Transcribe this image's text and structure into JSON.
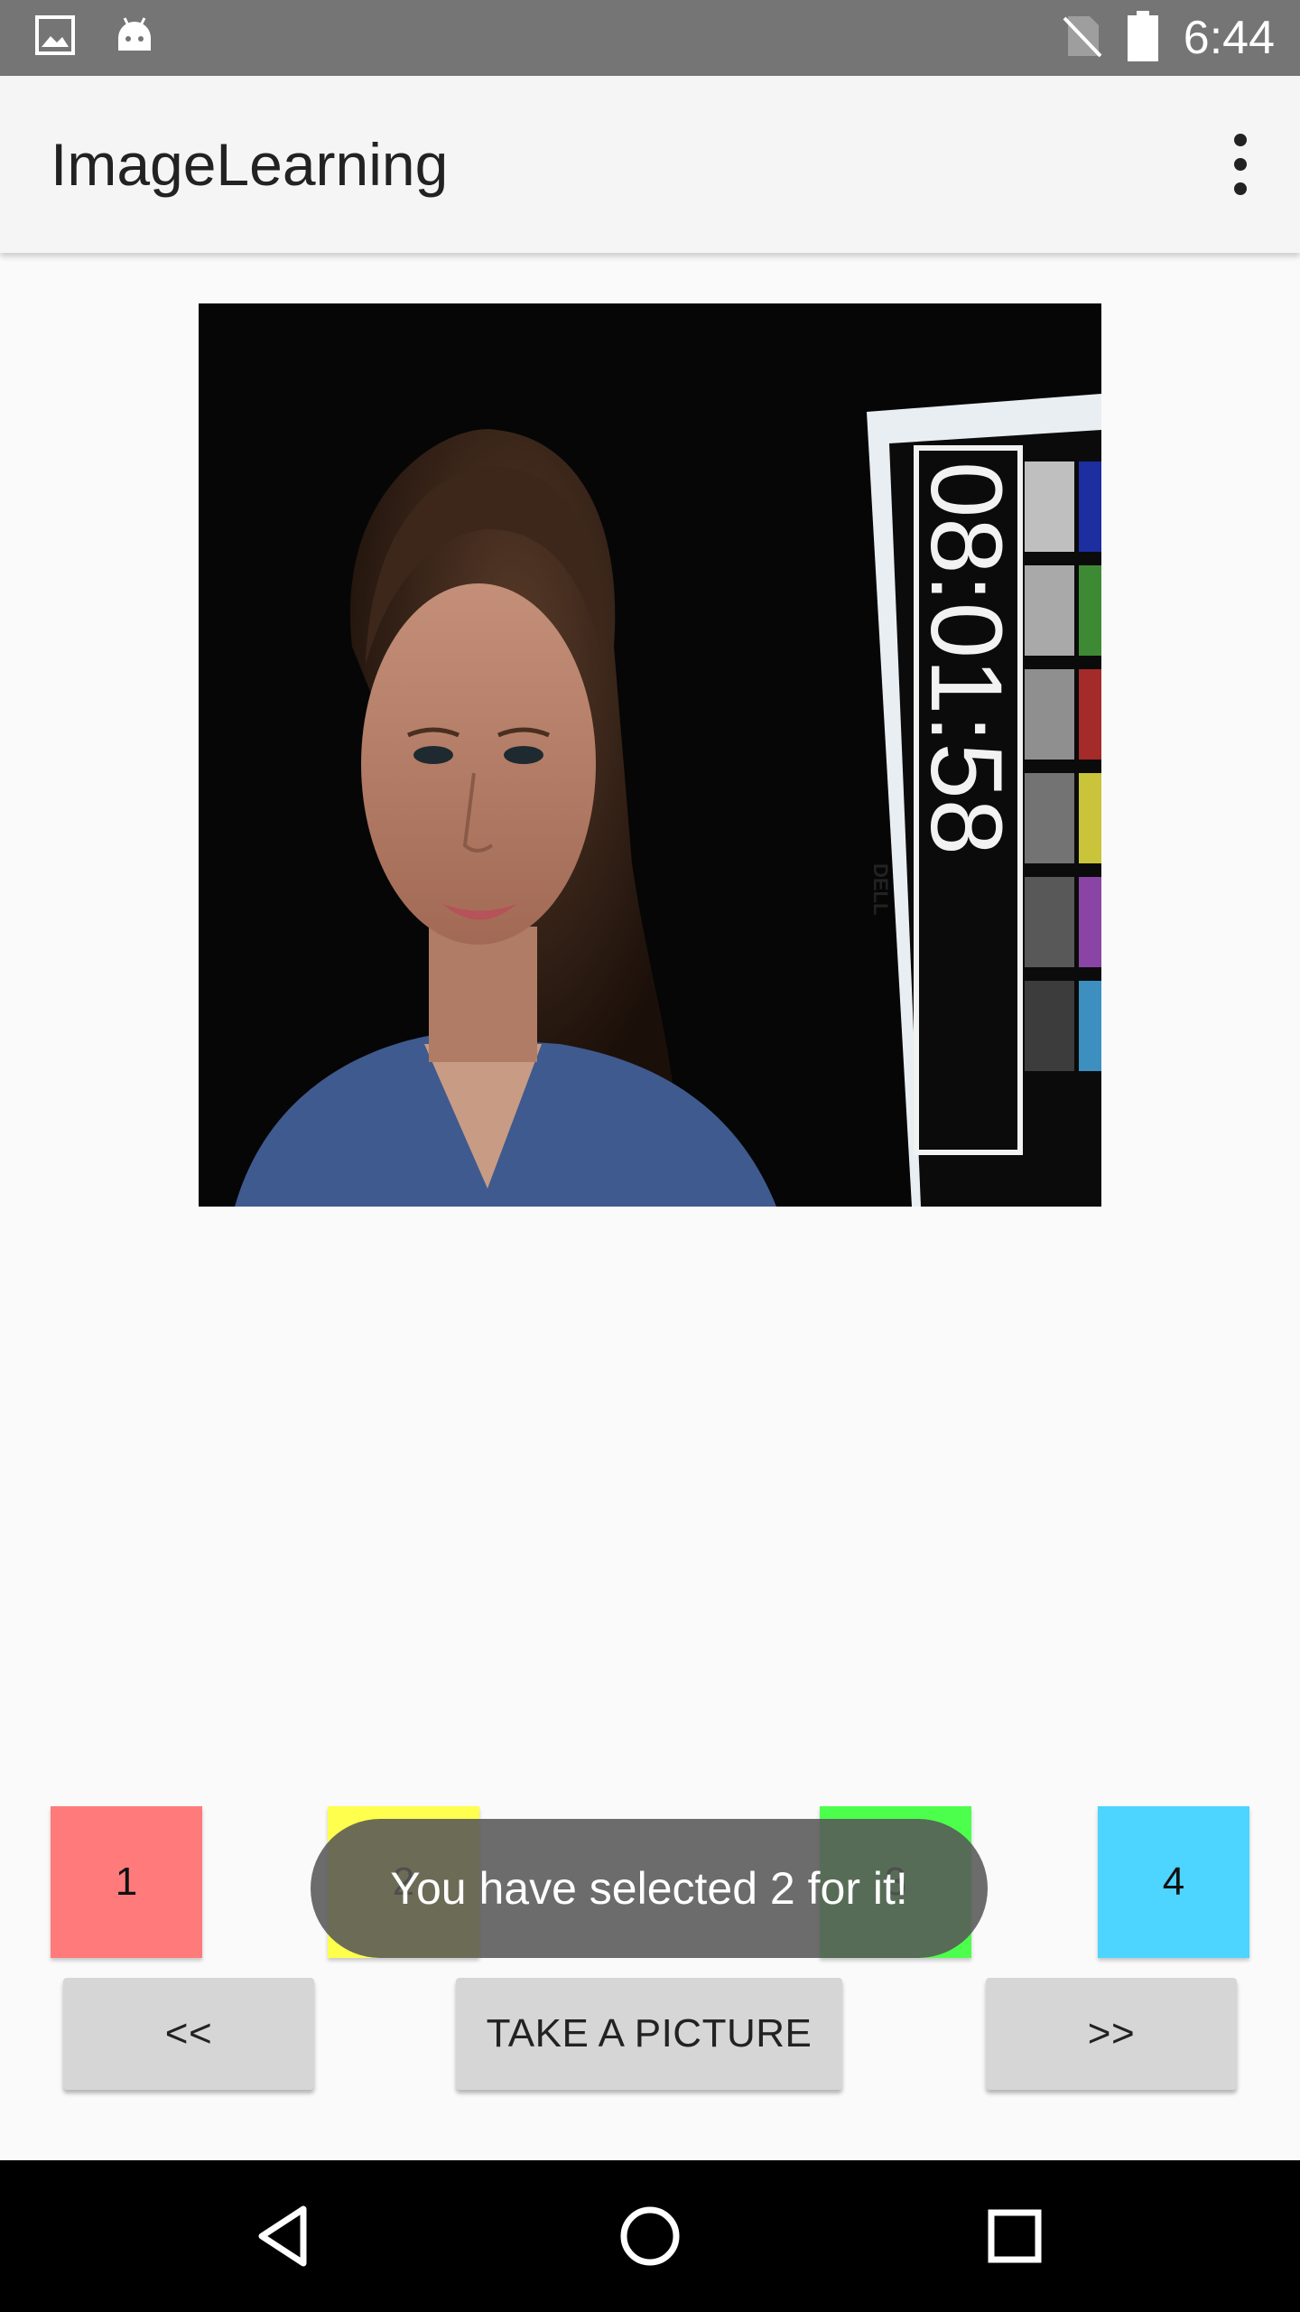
{
  "status_bar": {
    "time": "6:44",
    "left_icons": [
      "image-icon",
      "android-icon"
    ],
    "right_icons": [
      "no-sim-icon",
      "battery-icon"
    ]
  },
  "app_bar": {
    "title": "ImageLearning",
    "menu_icon": "overflow-menu-icon"
  },
  "photo": {
    "clock_text": "08:01:58",
    "brand_text": "DELL"
  },
  "choices": [
    {
      "label": "1",
      "color": "#ff7b7b"
    },
    {
      "label": "2",
      "color": "#ffff4d"
    },
    {
      "label": "3",
      "color": "#4dff4d"
    },
    {
      "label": "4",
      "color": "#4dd4ff"
    }
  ],
  "buttons": {
    "prev": "<<",
    "take_picture": "TAKE A PICTURE",
    "next": ">>"
  },
  "toast": {
    "message": "You have selected 2 for it!"
  },
  "nav_bar": {
    "back_icon": "back-icon",
    "home_icon": "home-icon",
    "recents_icon": "recents-icon"
  }
}
